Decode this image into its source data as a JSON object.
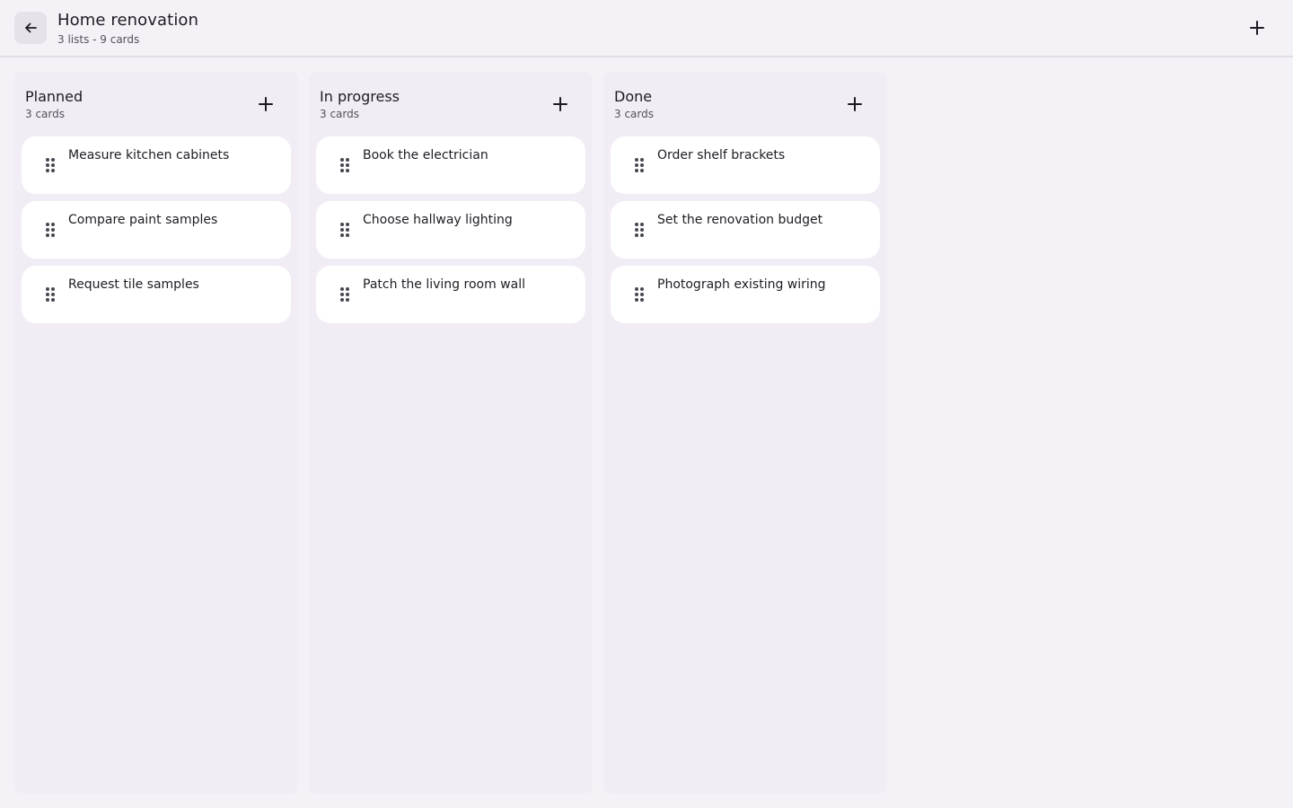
{
  "header": {
    "title": "Home renovation",
    "subtitle": "3 lists - 9 cards",
    "back_icon": "arrow-left-icon",
    "add_icon": "plus-icon"
  },
  "columns": [
    {
      "title": "Planned",
      "count": "3 cards",
      "cards": [
        "Measure kitchen cabinets",
        "Compare paint samples",
        "Request tile samples"
      ]
    },
    {
      "title": "In progress",
      "count": "3 cards",
      "cards": [
        "Book the electrician",
        "Choose hallway lighting",
        "Patch the living room wall"
      ]
    },
    {
      "title": "Done",
      "count": "3 cards",
      "cards": [
        "Order shelf brackets",
        "Set the renovation budget",
        "Photograph existing wiring"
      ]
    }
  ],
  "colors": {
    "background": "#f4f2f7",
    "column": "#f2edf5",
    "card": "#ffffff",
    "text": "#1f1b22",
    "muted": "#55505a"
  }
}
